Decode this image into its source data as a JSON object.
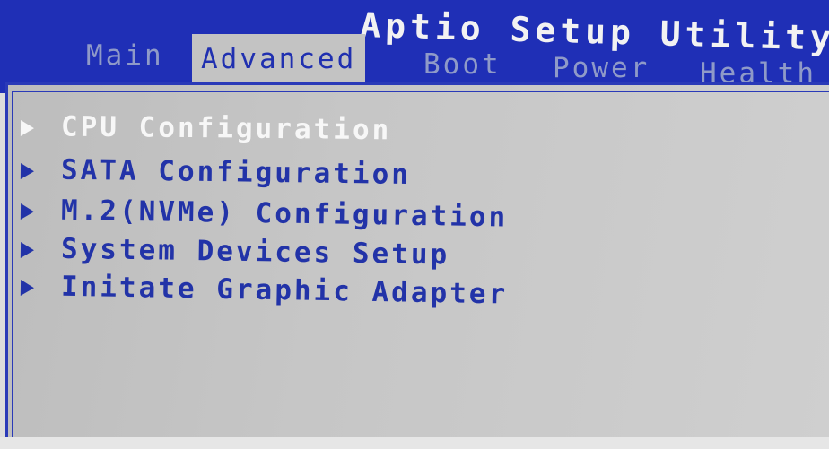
{
  "header": {
    "title": "Aptio Setup Utility - ",
    "tabs": [
      {
        "label": "Main",
        "active": false
      },
      {
        "label": "Advanced",
        "active": true
      },
      {
        "label": "Boot",
        "active": false
      },
      {
        "label": "Power",
        "active": false
      },
      {
        "label": "Health",
        "active": false
      }
    ]
  },
  "menu": {
    "items": [
      {
        "label": "CPU Configuration",
        "selected": true
      },
      {
        "label": "SATA Configuration",
        "selected": false
      },
      {
        "label": "M.2(NVMe) Configuration",
        "selected": false
      },
      {
        "label": "System Devices Setup",
        "selected": false
      },
      {
        "label": "Initate Graphic Adapter",
        "selected": false
      }
    ]
  },
  "colors": {
    "header_blue": "#1f2fb6",
    "panel_gray": "#c6c6c6",
    "item_blue": "#2233a8",
    "selected_white": "#f7f7f7",
    "inactive_tab": "#8f9ac8"
  },
  "icons": {
    "submenu": "triangle-right-icon"
  }
}
